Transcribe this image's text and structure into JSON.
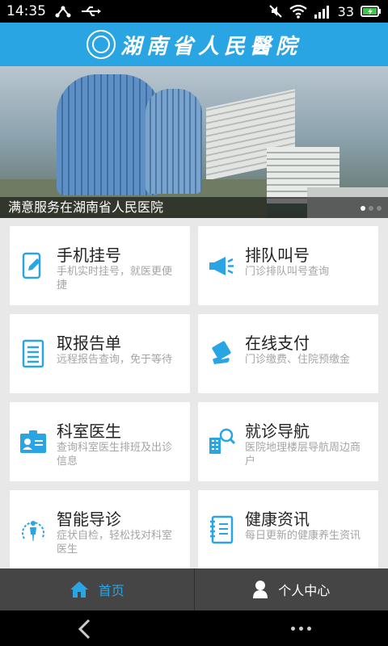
{
  "status_bar": {
    "time": "14:35",
    "battery": "33"
  },
  "header": {
    "title": "湖南省人民醫院"
  },
  "banner": {
    "caption": "满意服务在湖南省人民医院"
  },
  "menu": [
    {
      "title": "手机挂号",
      "desc": "手机实时挂号，就医更便捷",
      "icon": "phone-register-icon"
    },
    {
      "title": "排队叫号",
      "desc": "门诊排队叫号查询",
      "icon": "megaphone-icon"
    },
    {
      "title": "取报告单",
      "desc": "远程报告查询，免于等待",
      "icon": "report-icon"
    },
    {
      "title": "在线支付",
      "desc": "门诊缴费、住院预缴金",
      "icon": "payment-icon"
    },
    {
      "title": "科室医生",
      "desc": "查询科室医生排班及出诊信息",
      "icon": "doctor-card-icon"
    },
    {
      "title": "就诊导航",
      "desc": "医院地理楼层导航周边商户",
      "icon": "navigation-icon"
    },
    {
      "title": "智能导诊",
      "desc": "症状自检，轻松找对科室医生",
      "icon": "body-check-icon"
    },
    {
      "title": "健康资讯",
      "desc": "每日更新的健康养生资讯",
      "icon": "notebook-icon"
    }
  ],
  "tabs": {
    "home": "首页",
    "profile": "个人中心"
  },
  "colors": {
    "accent": "#2aa5e4",
    "tabbar": "#454545"
  }
}
